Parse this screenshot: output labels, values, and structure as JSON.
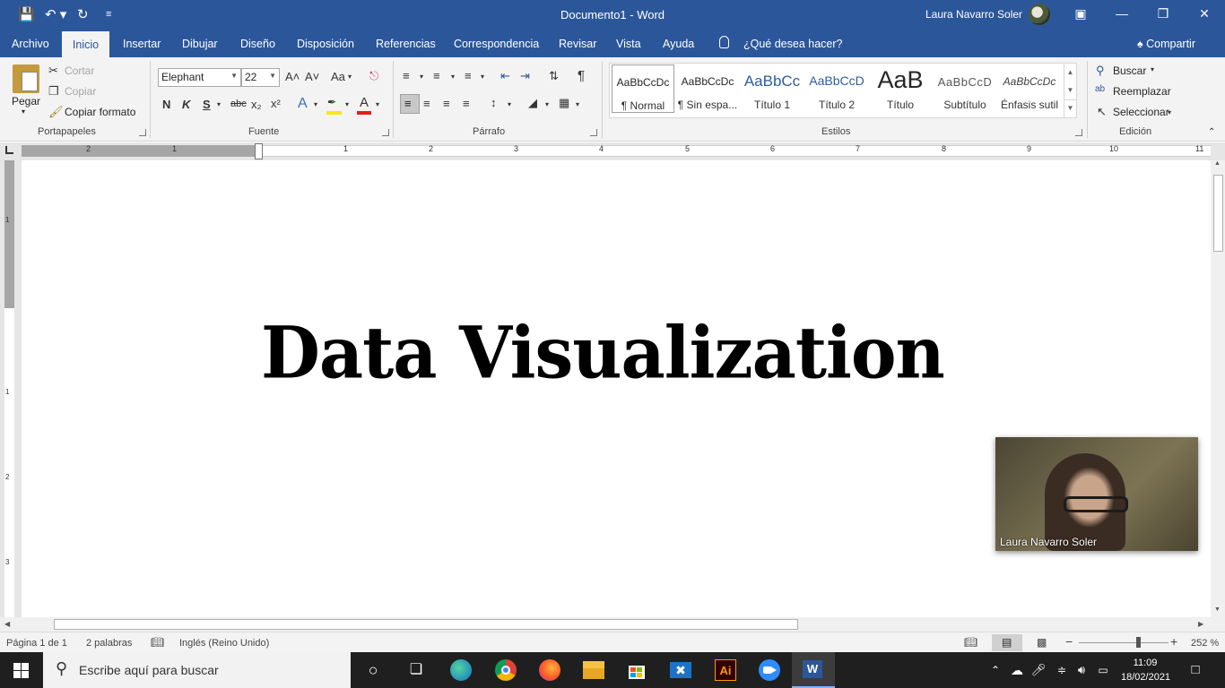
{
  "window": {
    "title": "Documento1  -  Word",
    "user": "Laura Navarro Soler",
    "qat": {
      "save": "💾",
      "undo": "↶ ▾",
      "redo": "↻",
      "customize": "≡"
    },
    "controls": {
      "ribbon_display": "▣",
      "minimize": "—",
      "restore": "❐",
      "close": "✕"
    }
  },
  "tabs": {
    "archivo": "Archivo",
    "inicio": "Inicio",
    "insertar": "Insertar",
    "dibujar": "Dibujar",
    "diseno": "Diseño",
    "disposicion": "Disposición",
    "referencias": "Referencias",
    "correspondencia": "Correspondencia",
    "revisar": "Revisar",
    "vista": "Vista",
    "ayuda": "Ayuda",
    "tell_me": "¿Qué desea hacer?",
    "share": "Compartir"
  },
  "clipboard": {
    "group": "Portapapeles",
    "paste": "Pegar",
    "cut": "Cortar",
    "copy": "Copiar",
    "format_painter": "Copiar formato"
  },
  "font": {
    "group": "Fuente",
    "name": "Elephant",
    "size": "22",
    "grow": "A˄",
    "shrink": "A˅",
    "case": "Aa",
    "bold": "N",
    "italic": "K",
    "underline": "S",
    "strike": "abc",
    "subscript": "x₂",
    "superscript": "x²"
  },
  "paragraph": {
    "group": "Párrafo"
  },
  "styles": {
    "group": "Estilos",
    "items": [
      {
        "sample": "AaBbCcDc",
        "name": "¶ Normal"
      },
      {
        "sample": "AaBbCcDc",
        "name": "¶ Sin espa..."
      },
      {
        "sample": "AaBbCc",
        "name": "Título 1"
      },
      {
        "sample": "AaBbCcD",
        "name": "Título 2"
      },
      {
        "sample": "AaB",
        "name": "Título"
      },
      {
        "sample": "AaBbCcD",
        "name": "Subtítulo"
      },
      {
        "sample": "AaBbCcDc",
        "name": "Énfasis sutil"
      }
    ]
  },
  "editing": {
    "group": "Edición",
    "find": "Buscar",
    "replace": "Reemplazar",
    "select": "Seleccionar"
  },
  "ruler": {
    "numbers": [
      "2",
      "1",
      "1",
      "2",
      "3",
      "4",
      "5",
      "6",
      "7",
      "8",
      "9",
      "10",
      "11"
    ],
    "vnumbers": [
      "1",
      "1",
      "2",
      "3"
    ]
  },
  "document": {
    "heading": "Data Visualization"
  },
  "video": {
    "label": "Laura Navarro Soler"
  },
  "status": {
    "page": "Página 1 de 1",
    "words": "2 palabras",
    "language": "Inglés (Reino Unido)",
    "zoom": "252 %"
  },
  "taskbar": {
    "search_placeholder": "Escribe aquí para buscar",
    "time": "11:09",
    "date": "18/02/2021"
  },
  "colors": {
    "word_blue": "#2b579a",
    "ribbon_bg": "#f3f3f3",
    "taskbar": "#1f1f1f"
  }
}
